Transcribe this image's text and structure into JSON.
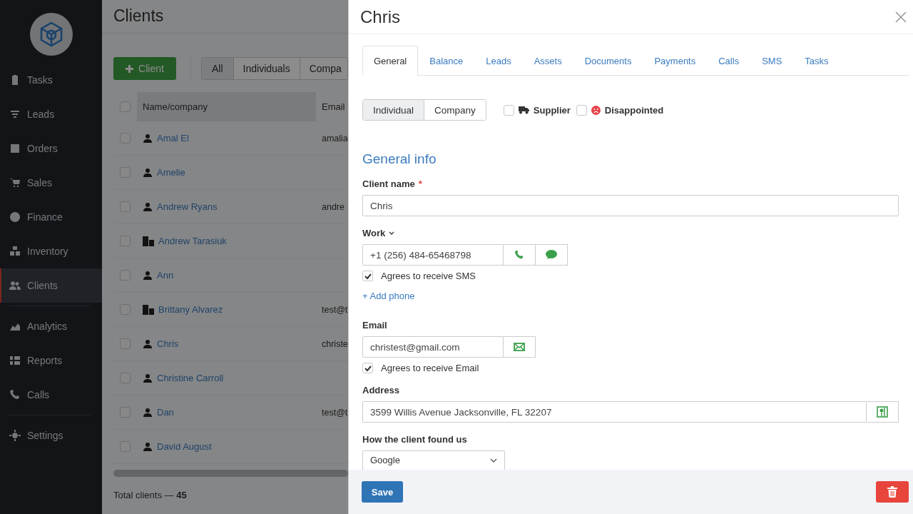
{
  "sidebar": {
    "groups": [
      [
        {
          "label": "Tasks",
          "selected": false
        },
        {
          "label": "Leads",
          "selected": false
        },
        {
          "label": "Orders",
          "selected": false
        },
        {
          "label": "Sales",
          "selected": false
        },
        {
          "label": "Finance",
          "selected": false
        },
        {
          "label": "Inventory",
          "selected": false
        },
        {
          "label": "Clients",
          "selected": true
        }
      ],
      [
        {
          "label": "Analytics",
          "selected": false
        },
        {
          "label": "Reports",
          "selected": false
        },
        {
          "label": "Calls",
          "selected": false
        }
      ],
      [
        {
          "label": "Settings",
          "selected": false
        }
      ]
    ]
  },
  "page": {
    "title": "Clients",
    "add_button": "Client",
    "filters": [
      {
        "label": "All",
        "selected": true
      },
      {
        "label": "Individuals",
        "selected": false
      },
      {
        "label": "Compa",
        "selected": false
      }
    ],
    "table": {
      "select_all_checked": false,
      "columns": [
        "Name/company",
        "Email"
      ],
      "rows": [
        {
          "name": "Amal El",
          "email": "amalia",
          "kind": "person",
          "checked": false
        },
        {
          "name": "Amelie",
          "email": "",
          "kind": "person",
          "checked": false
        },
        {
          "name": "Andrew Ryans",
          "email": "andre",
          "kind": "person",
          "checked": false
        },
        {
          "name": "Andrew Tarasiuk",
          "email": "",
          "kind": "company",
          "checked": false
        },
        {
          "name": "Ann",
          "email": "",
          "kind": "person",
          "checked": false
        },
        {
          "name": "Brittany Alvarez",
          "email": "test@t",
          "kind": "company",
          "checked": false
        },
        {
          "name": "Chris",
          "email": "christe",
          "kind": "person",
          "checked": false
        },
        {
          "name": "Christine Carroll",
          "email": "",
          "kind": "person",
          "checked": false
        },
        {
          "name": "Dan",
          "email": "test@t",
          "kind": "person",
          "checked": false
        },
        {
          "name": "David August",
          "email": "",
          "kind": "person",
          "checked": false
        }
      ]
    },
    "footer": "Total clients — **45**"
  },
  "drawer": {
    "title": "Chris",
    "tabs": [
      {
        "label": "General",
        "selected": true
      },
      {
        "label": "Balance",
        "selected": false
      },
      {
        "label": "Leads",
        "selected": false
      },
      {
        "label": "Assets",
        "selected": false
      },
      {
        "label": "Documents",
        "selected": false
      },
      {
        "label": "Payments",
        "selected": false
      },
      {
        "label": "Calls",
        "selected": false
      },
      {
        "label": "SMS",
        "selected": false
      },
      {
        "label": "Tasks",
        "selected": false
      }
    ],
    "client_type": [
      {
        "label": "Individual",
        "selected": true
      },
      {
        "label": "Company",
        "selected": false
      }
    ],
    "flags": [
      {
        "label": "Supplier",
        "checked": false,
        "kind": "truck"
      },
      {
        "label": "Disappointed",
        "checked": false,
        "kind": "sad"
      }
    ],
    "section_title": "General info",
    "client_name": {
      "label": "Client name",
      "required_mark": "*",
      "value": "Chris"
    },
    "phone": {
      "label": "Work",
      "value": "+1 (256) 484-65468798",
      "consent": {
        "label": "Agrees to receive SMS",
        "checked": true
      },
      "add_link": "+ Add phone"
    },
    "email": {
      "label": "Email",
      "value": "christest@gmail.com",
      "consent": {
        "label": "Agrees to receive Email",
        "checked": true
      }
    },
    "address": {
      "label": "Address",
      "value": "3599 Willis Avenue Jacksonville, FL 32207"
    },
    "source": {
      "label": "How the client found us",
      "value": "Google"
    },
    "save": "Save"
  }
}
